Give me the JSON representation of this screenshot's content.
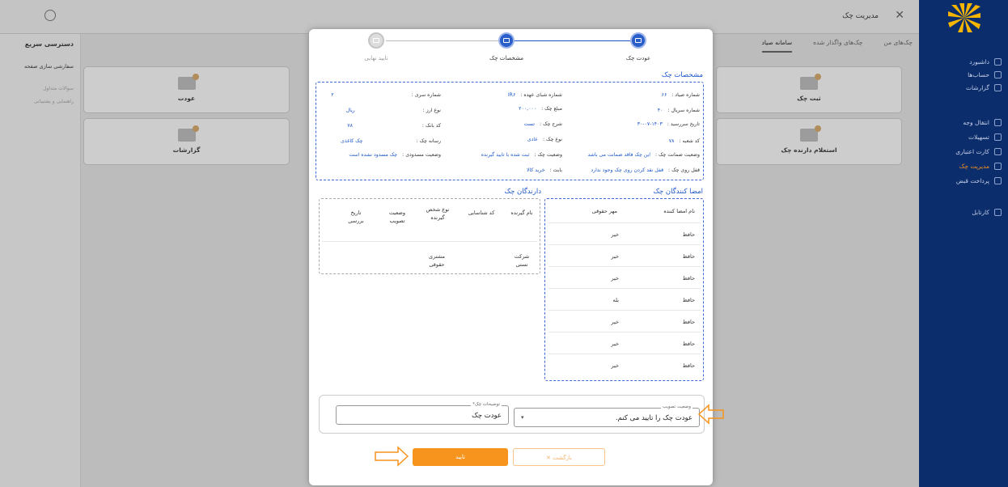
{
  "window": {
    "title": "مدیریت چک",
    "close_icon": "close-icon",
    "user_icon": "user-icon"
  },
  "sidebar": {
    "items": [
      {
        "label": "داشبورد",
        "icon": "dashboard-icon"
      },
      {
        "label": "حساب‌ها",
        "icon": "bank-icon"
      },
      {
        "label": "گزارشات",
        "icon": "report-icon"
      },
      {
        "label": "انتقال وجه",
        "icon": "transfer-icon"
      },
      {
        "label": "تسهیلات",
        "icon": "loan-icon"
      },
      {
        "label": "کارت اعتباری",
        "icon": "card-icon"
      },
      {
        "label": "مدیریت چک",
        "icon": "cheque-icon",
        "active": true
      },
      {
        "label": "پرداخت قبض",
        "icon": "bill-icon"
      },
      {
        "label": "کارتابل",
        "icon": "inbox-icon"
      }
    ]
  },
  "left_panel": {
    "title": "دسترسی سریع",
    "customize": "سفارشی سازی صفحه",
    "faq": "سوالات متداول",
    "help": "راهنمایی و پشتیبانی"
  },
  "bg_tabs": [
    "چک‌های من",
    "چک‌های واگذار شده",
    "سامانه صیاد"
  ],
  "bg_cards": [
    "ثبت چک",
    "عودت",
    "استعلام دارنده چک",
    "گزارشات"
  ],
  "steps": [
    {
      "label": "عودت چک",
      "state": "done"
    },
    {
      "label": "مشخصات چک",
      "state": "active"
    },
    {
      "label": "تایید نهایی",
      "state": "pending"
    }
  ],
  "cheque_details": {
    "title": "مشخصات چک",
    "fields": {
      "sayad_label": "شماره صیاد :",
      "sayad_value": "۶۶",
      "issuer_label": "شماره شبای عهده :",
      "issuer_value": "IR۶",
      "series_label": "شماره سری :",
      "series_value": "۲",
      "serial_label": "شماره سریال :",
      "serial_value": "۴۰",
      "amount_label": "مبلغ چک :",
      "amount_value": "۲۰۰,۰۰۰",
      "currency_label": "نوع ارز :",
      "currency_value": "ریال",
      "due_label": "تاریخ سررسید :",
      "due_value": "۱۴۰۳-۰۷-۳۰",
      "desc_label": "شرح چک :",
      "desc_value": "تست",
      "bank_label": "کد بانک :",
      "bank_value": "۷۸",
      "branch_label": "کد شعبه :",
      "branch_value": "۷۸",
      "type_label": "نوع چک :",
      "type_value": "عادی",
      "media_label": "رسانه چک :",
      "media_value": "چک کاغذی",
      "guarantee_label": "وضعیت ضمانت چک :",
      "guarantee_value": "این چک فاقد ضمانت می باشد",
      "status_label": "وضعیت چک :",
      "status_value": "ثبت شده با تایید گیرنده",
      "block_label": "وضعیت مسدودی :",
      "block_value": "چک مسدود نشده است",
      "lock_label": "قفل روی چک :",
      "lock_value": "قفل نقد کردن روی چک وجود ندارد",
      "reason_label": "بابت :",
      "reason_value": "خرید کالا"
    }
  },
  "signers": {
    "title": "امضا کنندگان چک",
    "headers": [
      "نام امضا کننده",
      "مهر حقوقی"
    ],
    "rows": [
      [
        "حافظ",
        "خیر"
      ],
      [
        "حافظ",
        "خیر"
      ],
      [
        "حافظ",
        "خیر"
      ],
      [
        "حافظ",
        "بله"
      ],
      [
        "حافظ",
        "خیر"
      ],
      [
        "حافظ",
        "خیر"
      ],
      [
        "حافظ",
        "خیر"
      ]
    ]
  },
  "holders": {
    "title": "دارندگان چک",
    "headers": [
      "نام گیرنده",
      "کد شناسایی",
      "نوع شخص گیرنده",
      "وضعیت تصویب",
      "تاریخ بررسی"
    ],
    "rows": [
      [
        "شرکت تستی",
        "",
        "مشتری حقوقی",
        "",
        ""
      ]
    ]
  },
  "form": {
    "approval_legend": "وضعیت تصویب",
    "approval_value": "عودت چک را تایید می کنم.",
    "desc_legend": "توضیحات چک*",
    "desc_value": "عودت چک"
  },
  "buttons": {
    "confirm": "تایید",
    "back": "بازگشت"
  },
  "colors": {
    "primary": "#1a55c8",
    "accent": "#f7941d",
    "sidebar": "#0c2d6b"
  }
}
